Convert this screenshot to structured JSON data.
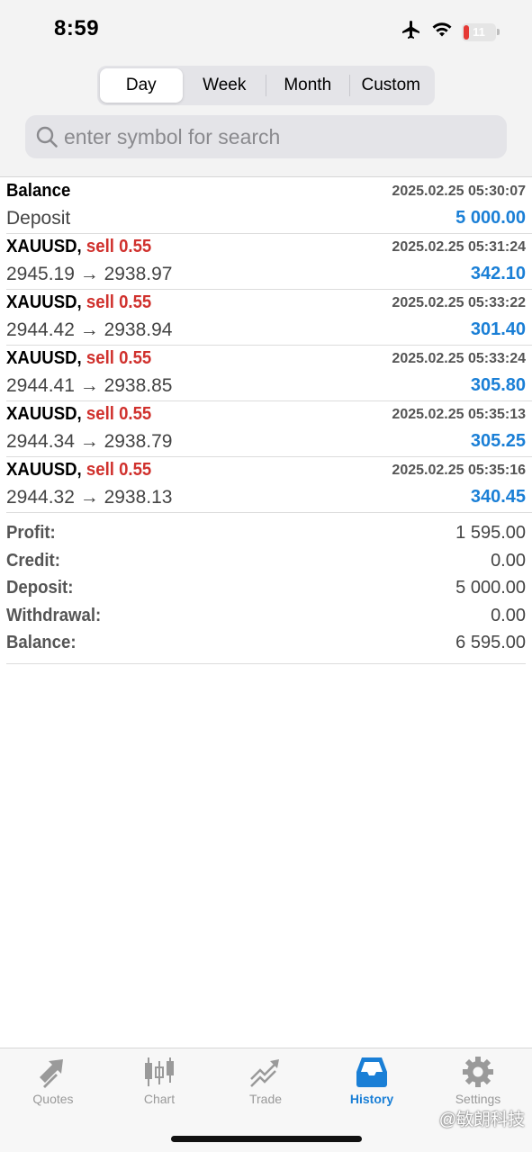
{
  "status_bar": {
    "time": "8:59",
    "battery": "11"
  },
  "period_tabs": [
    {
      "label": "Day",
      "active": true
    },
    {
      "label": "Week",
      "active": false
    },
    {
      "label": "Month",
      "active": false
    },
    {
      "label": "Custom",
      "active": false
    }
  ],
  "search": {
    "placeholder": "enter symbol for search",
    "value": ""
  },
  "history": [
    {
      "title": "Balance",
      "action": "",
      "date": "2025.02.25 05:30:07",
      "sub": "Deposit",
      "amount": "5 000.00"
    },
    {
      "title": "XAUUSD,",
      "action": "sell 0.55",
      "date": "2025.02.25 05:31:24",
      "sub": "2945.19 → 2938.97",
      "amount": "342.10"
    },
    {
      "title": "XAUUSD,",
      "action": "sell 0.55",
      "date": "2025.02.25 05:33:22",
      "sub": "2944.42 → 2938.94",
      "amount": "301.40"
    },
    {
      "title": "XAUUSD,",
      "action": "sell 0.55",
      "date": "2025.02.25 05:33:24",
      "sub": "2944.41 → 2938.85",
      "amount": "305.80"
    },
    {
      "title": "XAUUSD,",
      "action": "sell 0.55",
      "date": "2025.02.25 05:35:13",
      "sub": "2944.34 → 2938.79",
      "amount": "305.25"
    },
    {
      "title": "XAUUSD,",
      "action": "sell 0.55",
      "date": "2025.02.25 05:35:16",
      "sub": "2944.32 → 2938.13",
      "amount": "340.45"
    }
  ],
  "summary": [
    {
      "label": "Profit:",
      "value": "1 595.00"
    },
    {
      "label": "Credit:",
      "value": "0.00"
    },
    {
      "label": "Deposit:",
      "value": "5 000.00"
    },
    {
      "label": "Withdrawal:",
      "value": "0.00"
    },
    {
      "label": "Balance:",
      "value": "6 595.00"
    }
  ],
  "tabbar": {
    "quotes": {
      "label": "Quotes",
      "icon": "quotes-icon"
    },
    "chart": {
      "label": "Chart",
      "icon": "candlestick-icon"
    },
    "trade": {
      "label": "Trade",
      "icon": "trade-icon"
    },
    "history": {
      "label": "History",
      "icon": "inbox-icon",
      "active": true
    },
    "settings": {
      "label": "Settings",
      "icon": "gear-icon"
    }
  },
  "watermark": "@敏朗科技",
  "colors": {
    "accent": "#1a7fd6",
    "sell": "#d0312d",
    "inactive_tab": "#999999"
  }
}
